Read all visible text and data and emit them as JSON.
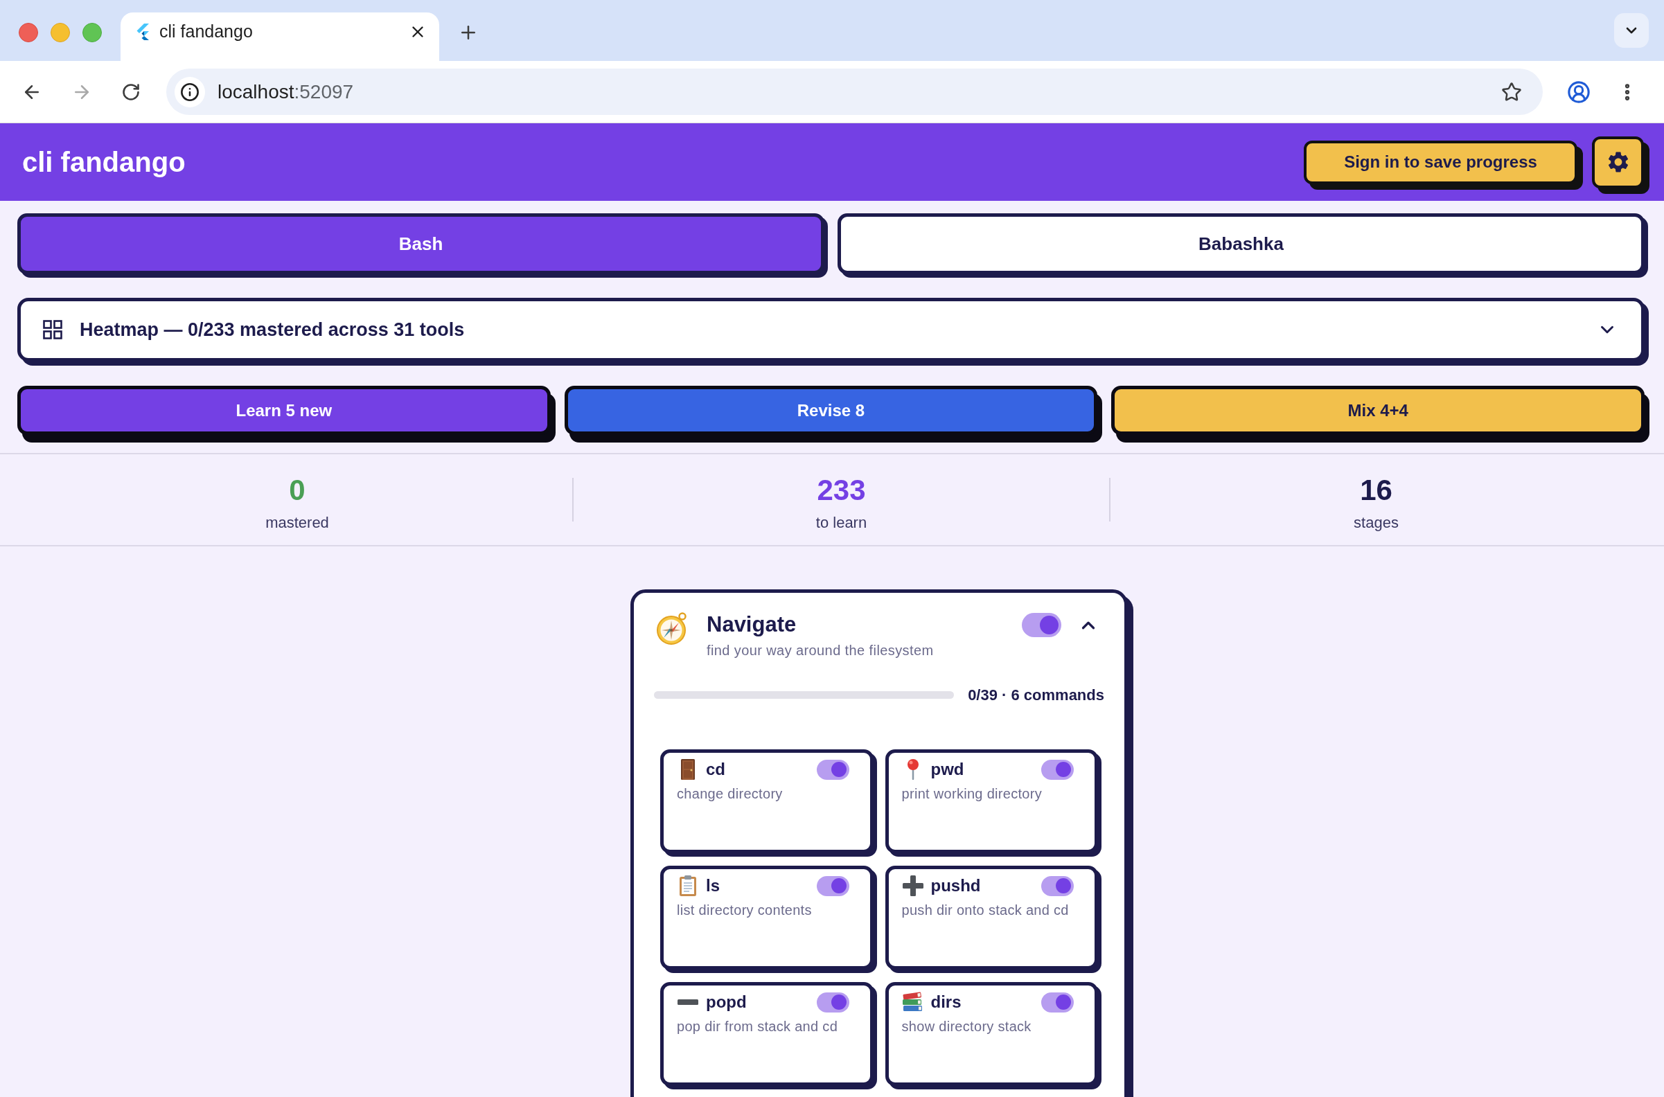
{
  "browser": {
    "tabs": [
      {
        "title": "cli fandango",
        "selected": true
      }
    ],
    "forward_disabled": true,
    "address": {
      "host": "localhost",
      "rest": ":52097"
    }
  },
  "header": {
    "title": "cli fandango",
    "sign_in": "Sign in to save progress"
  },
  "language_tabs": [
    {
      "label": "Bash",
      "selected": true
    },
    {
      "label": "Babashka",
      "selected": false
    }
  ],
  "heatmap": {
    "label": "Heatmap — 0/233 mastered across 31 tools",
    "expanded": false
  },
  "actions": [
    {
      "label": "Learn 5 new",
      "color": "#7440e4"
    },
    {
      "label": "Revise 8",
      "color": "#3764e2"
    },
    {
      "label": "Mix 4+4",
      "color": "#f2c04c"
    }
  ],
  "stats": [
    {
      "value": "0",
      "label": "mastered",
      "color": "#4a9f55"
    },
    {
      "value": "233",
      "label": "to learn",
      "color": "#7440e4"
    },
    {
      "value": "16",
      "label": "stages",
      "color": "#1d1b4c"
    }
  ],
  "stages": [
    {
      "title": "Navigate",
      "subtitle": "find your way around the filesystem",
      "on": true,
      "expanded": true,
      "level": 0,
      "progress": "0/39 · 6 commands",
      "commands": [
        {
          "name": "cd",
          "description": "change directory",
          "on": true
        },
        {
          "name": "pwd",
          "description": "print working directory",
          "on": true
        },
        {
          "name": "ls",
          "description": "list directory contents",
          "on": true
        },
        {
          "name": "pushd",
          "description": "push dir onto stack and cd",
          "on": true
        },
        {
          "name": "popd",
          "description": "pop dir from stack and cd",
          "on": true
        },
        {
          "name": "dirs",
          "description": "show directory stack",
          "on": true
        }
      ]
    }
  ]
}
